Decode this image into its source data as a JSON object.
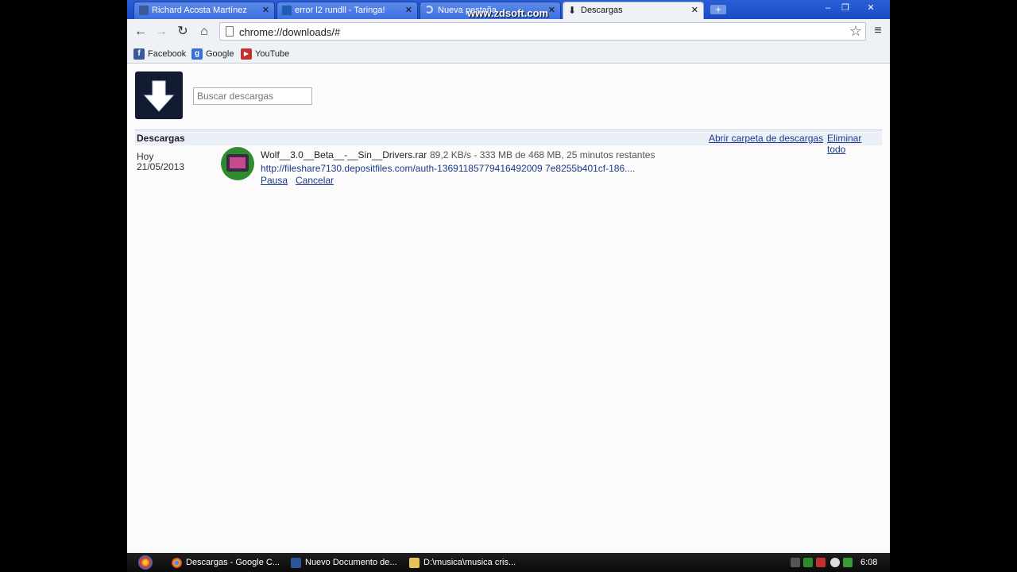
{
  "watermark": "www.zdsoft.com",
  "tabs": [
    {
      "label": "Richard Acosta Martínez",
      "icon": "facebook-icon",
      "color": "#3b5998"
    },
    {
      "label": "error l2 rundll - Taringa!",
      "icon": "taringa-icon",
      "color": "#1a5fb4"
    },
    {
      "label": "Nueva pestaña",
      "icon": "loading-icon",
      "color": "#2a5fd8"
    },
    {
      "label": "Descargas",
      "icon": "download-icon",
      "color": "#222222"
    }
  ],
  "toolbar": {
    "url": "chrome://downloads/#"
  },
  "bookmarks": [
    {
      "label": "Facebook",
      "icon": "facebook-icon",
      "color": "#3b5998",
      "glyph": "f"
    },
    {
      "label": "Google",
      "icon": "google-icon",
      "color": "#3a6fd8",
      "glyph": "g"
    },
    {
      "label": "YouTube",
      "icon": "youtube-icon",
      "color": "#c4302b",
      "glyph": "▶"
    }
  ],
  "page": {
    "search_placeholder": "Buscar descargas",
    "section_title": "Descargas",
    "open_folder_link": "Abrir carpeta de descargas",
    "clear_all_link": "Eliminar todo",
    "download": {
      "date_label": "Hoy",
      "date": "21/05/2013",
      "file_name": "Wolf__3.0__Beta__-__Sin__Drivers.rar",
      "status": "89,2 KB/s - 333 MB de 468 MB, 25 minutos restantes",
      "url": "http://fileshare7130.depositfiles.com/auth-13691185779416492009 7e8255b401cf-186....",
      "pause_label": "Pausa",
      "cancel_label": "Cancelar"
    }
  },
  "taskbar": {
    "items": [
      {
        "label": "Descargas - Google C...",
        "icon": "chrome-icon",
        "color": "#e8b923"
      },
      {
        "label": "Nuevo Documento de...",
        "icon": "word-icon",
        "color": "#2b5797"
      },
      {
        "label": "D:\\musica\\musica cris...",
        "icon": "folder-icon",
        "color": "#e8c25a"
      }
    ],
    "clock": "6:08"
  }
}
